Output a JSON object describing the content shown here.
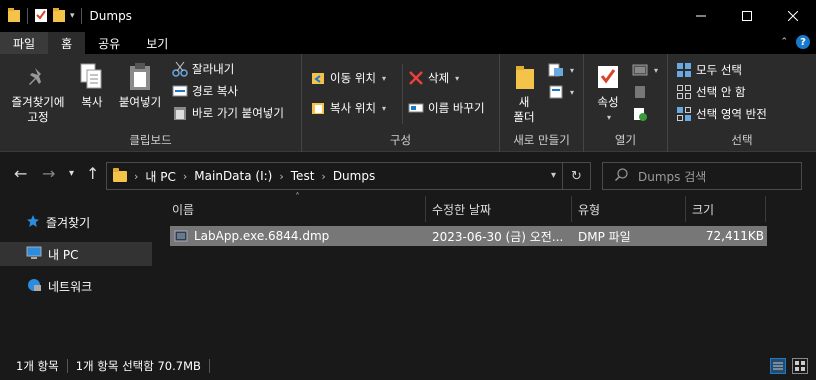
{
  "window": {
    "title": "Dumps"
  },
  "tabs": [
    "파일",
    "홈",
    "공유",
    "보기"
  ],
  "ribbon": {
    "clipboard": {
      "pin": "즐겨찾기에\n고정",
      "copy": "복사",
      "paste": "붙여넣기",
      "cut": "잘라내기",
      "copy_path": "경로 복사",
      "paste_shortcut": "바로 가기 붙여넣기",
      "label": "클립보드"
    },
    "organize": {
      "move_to": "이동 위치",
      "copy_to": "복사 위치",
      "delete": "삭제",
      "rename": "이름 바꾸기",
      "label": "구성"
    },
    "new": {
      "new_folder": "새\n폴더",
      "label": "새로 만들기"
    },
    "open": {
      "properties": "속성",
      "label": "열기"
    },
    "select": {
      "select_all": "모두 선택",
      "select_none": "선택 안 함",
      "invert": "선택 영역 반전",
      "label": "선택"
    }
  },
  "address": {
    "crumbs": [
      "내 PC",
      "MainData (I:)",
      "Test",
      "Dumps"
    ],
    "search_placeholder": "Dumps 검색"
  },
  "navpane": {
    "items": [
      {
        "label": "즐겨찾기",
        "icon": "star-icon"
      },
      {
        "label": "내 PC",
        "icon": "computer-icon"
      },
      {
        "label": "네트워크",
        "icon": "network-icon"
      }
    ]
  },
  "columns": [
    "이름",
    "수정한 날짜",
    "유형",
    "크기"
  ],
  "files": [
    {
      "name": "LabApp.exe.6844.dmp",
      "modified": "2023-06-30 (금) 오전...",
      "type": "DMP 파일",
      "size": "72,411KB"
    }
  ],
  "status": {
    "count": "1개 항목",
    "selected": "1개 항목 선택함 70.7MB"
  },
  "colors": {
    "accent": "#1979ca",
    "selection": "#777777"
  }
}
